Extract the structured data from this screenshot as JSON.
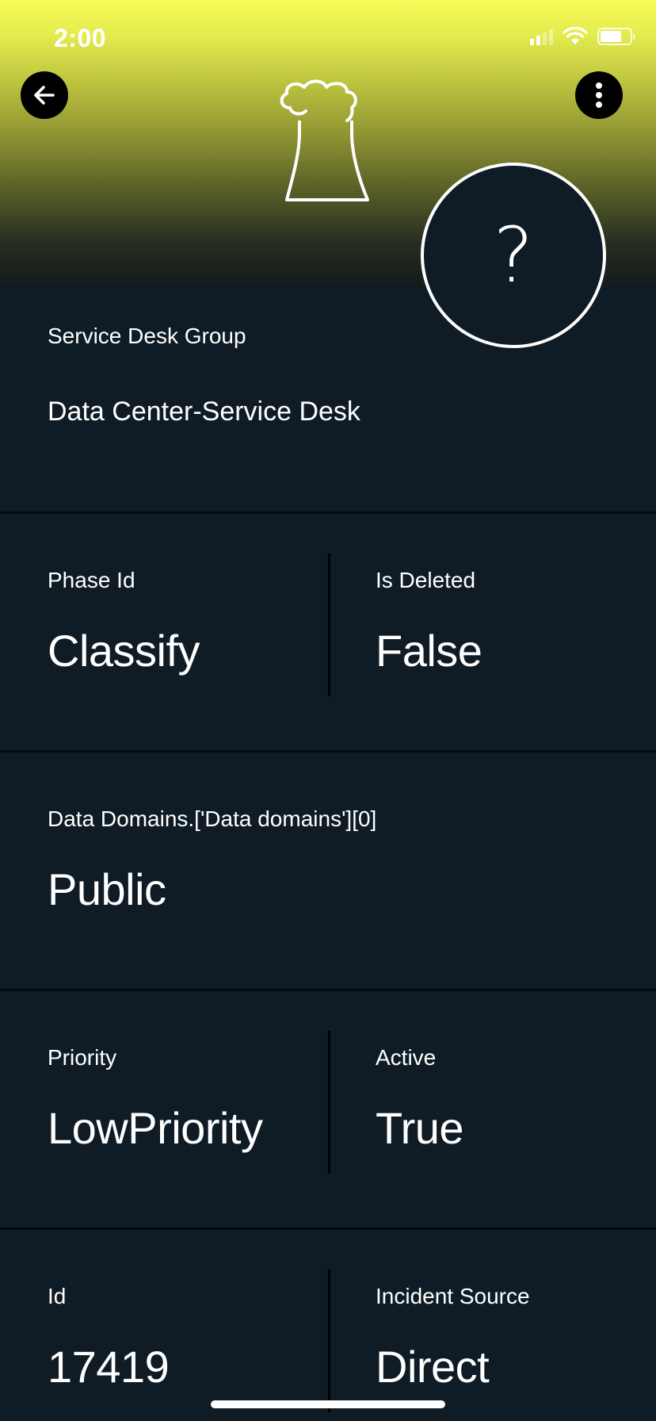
{
  "status_bar": {
    "time": "2:00"
  },
  "header": {
    "back_icon": "arrow-left-icon",
    "more_icon": "vertical-ellipsis-icon",
    "hero_icon": "power-plant-cooling-tower-icon",
    "avatar_glyph": "?",
    "gradient_colors": [
      "#f6fb58",
      "#141c1e"
    ]
  },
  "colors": {
    "background": "#101c25",
    "card_separator": "#05090c",
    "text": "#ffffff"
  },
  "fields": {
    "service_desk_group": {
      "label": "Service Desk Group",
      "value": "Data Center-Service Desk"
    },
    "phase_id": {
      "label": "Phase Id",
      "value": "Classify"
    },
    "is_deleted": {
      "label": "Is Deleted",
      "value": "False"
    },
    "data_domains": {
      "label": "Data Domains.['Data domains'][0]",
      "value": "Public"
    },
    "priority": {
      "label": "Priority",
      "value": "LowPriority"
    },
    "active": {
      "label": "Active",
      "value": "True"
    },
    "id": {
      "label": "Id",
      "value": "17419"
    },
    "incident_source": {
      "label": "Incident Source",
      "value": "Direct"
    }
  }
}
